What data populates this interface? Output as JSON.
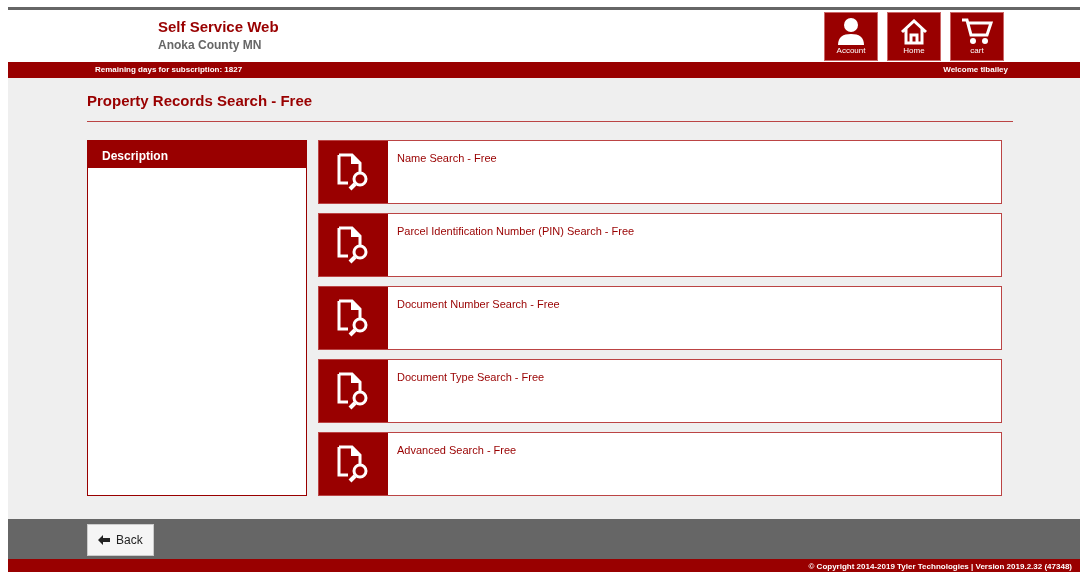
{
  "header": {
    "title": "Self Service Web",
    "subtitle": "Anoka County MN",
    "buttons": [
      {
        "kind": "account",
        "label": "Account"
      },
      {
        "kind": "home",
        "label": "Home"
      },
      {
        "kind": "cart",
        "label": "cart"
      }
    ]
  },
  "subscription": "Remaining days for subscription: 1827",
  "welcome": "Welcome tlbailey",
  "page_title": "Property Records Search - Free",
  "description": {
    "title": "Description"
  },
  "searches": [
    {
      "label": "Name Search - Free"
    },
    {
      "label": "Parcel Identification Number (PIN) Search - Free"
    },
    {
      "label": "Document Number Search - Free"
    },
    {
      "label": "Document Type Search - Free"
    },
    {
      "label": "Advanced Search - Free"
    }
  ],
  "back_button": "Back",
  "copyright": "© Copyright 2014-2019 Tyler Technologies | Version 2019.2.32 (47348)"
}
